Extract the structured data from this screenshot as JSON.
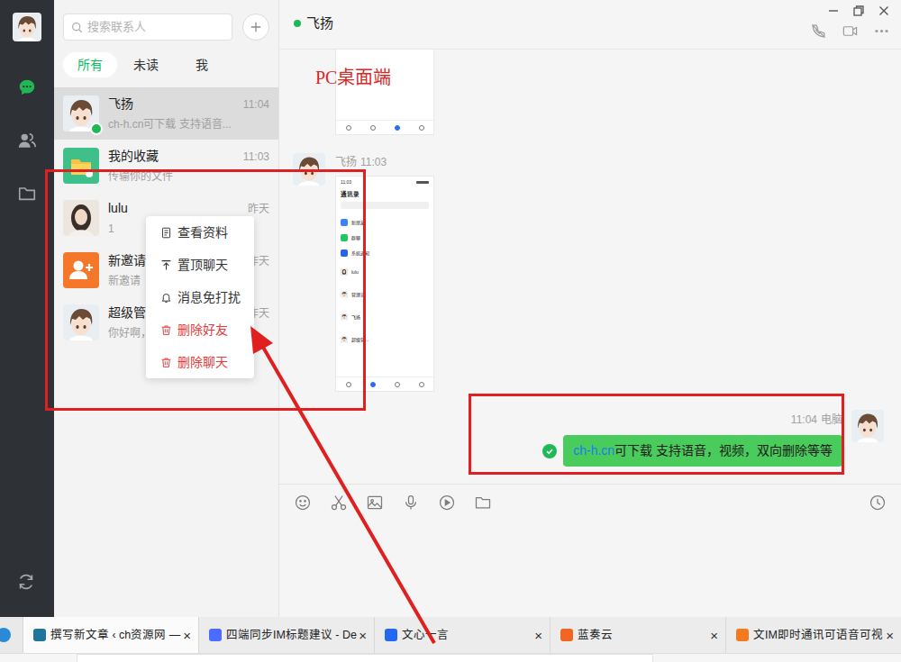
{
  "sidebar": {
    "items": [
      {
        "kind": "chat",
        "selected": true
      },
      {
        "kind": "contacts",
        "selected": false
      },
      {
        "kind": "folder",
        "selected": false
      }
    ]
  },
  "search": {
    "placeholder": "搜索联系人"
  },
  "filters": [
    {
      "label": "所有",
      "selected": true
    },
    {
      "label": "未读",
      "selected": false
    },
    {
      "label": "我",
      "selected": false
    }
  ],
  "contacts": [
    {
      "name": "飞扬",
      "time": "11:04",
      "preview": "ch-h.cn可下载 支持语音...",
      "kind": "person",
      "online": true,
      "selected": true
    },
    {
      "name": "我的收藏",
      "time": "11:03",
      "preview": "传输你的文件",
      "kind": "favorites",
      "online": false,
      "selected": false
    },
    {
      "name": "lulu",
      "time": "昨天",
      "preview": "1",
      "kind": "photo",
      "online": false,
      "selected": false
    },
    {
      "name": "新邀请",
      "time": "昨天",
      "preview": "新邀请",
      "kind": "invite",
      "online": false,
      "selected": false
    },
    {
      "name": "超级管",
      "time": "昨天",
      "preview": "你好啊，",
      "kind": "person",
      "online": false,
      "selected": false
    }
  ],
  "context_menu": [
    {
      "label": "查看资料",
      "kind": "profile",
      "danger": false
    },
    {
      "label": "置顶聊天",
      "kind": "pin",
      "danger": false
    },
    {
      "label": "消息免打扰",
      "kind": "bell",
      "danger": false
    },
    {
      "label": "删除好友",
      "kind": "trash",
      "danger": true
    },
    {
      "label": "删除聊天",
      "kind": "trash",
      "danger": true
    }
  ],
  "chat": {
    "title": "飞扬",
    "online": true,
    "messages": [
      {
        "kind": "image",
        "outgoing": false,
        "cropped": true,
        "screen": {
          "nav": [
            {
              "selected": false
            },
            {
              "selected": false
            },
            {
              "selected": true
            },
            {
              "selected": false
            }
          ]
        }
      },
      {
        "kind": "image",
        "outgoing": false,
        "cropped": false,
        "sender": "飞扬",
        "time": "11:03",
        "screen": {
          "time": "11:03",
          "title": "通讯录",
          "rows": [
            {
              "label": "新朋友",
              "kind": "tile",
              "color": "#3b82f6"
            },
            {
              "label": "群聊",
              "kind": "tile",
              "color": "#22c55e"
            },
            {
              "label": "系统通知",
              "kind": "tile",
              "color": "#2563eb"
            },
            {
              "label": "lulu",
              "kind": "photo",
              "color": "#d9cfc4"
            },
            {
              "label": "管理员",
              "kind": "avatar",
              "color": "#e9eef3"
            },
            {
              "label": "飞扬",
              "kind": "avatar",
              "color": "#e9eef3"
            },
            {
              "label": "超级管...",
              "kind": "avatar",
              "color": "#e9eef3"
            }
          ],
          "nav": [
            {
              "selected": false
            },
            {
              "selected": true
            },
            {
              "selected": false
            },
            {
              "selected": false
            }
          ]
        }
      },
      {
        "kind": "text",
        "outgoing": true,
        "time": "11:04",
        "device": "电脑",
        "link": "ch-h.cn",
        "text": "可下载 支持语音，视频，双向删除等等",
        "read": true
      }
    ]
  },
  "annotation": {
    "label": "PC桌面端"
  },
  "browser_tabs": [
    {
      "label": "撰写新文章 ‹ ch资源网 —",
      "close": "×",
      "selected": true,
      "color": "#21759b"
    },
    {
      "label": "四端同步IM标题建议 - De",
      "close": "×",
      "selected": false,
      "color": "#4d6bfe"
    },
    {
      "label": "文心一言",
      "close": "×",
      "selected": false,
      "color": "#2468f2"
    },
    {
      "label": "蓝奏云",
      "close": "×",
      "selected": false,
      "color": "#f26522"
    },
    {
      "label": "文IM即时通讯可语音可视",
      "close": "×",
      "selected": false,
      "color": "#f47a20"
    }
  ]
}
